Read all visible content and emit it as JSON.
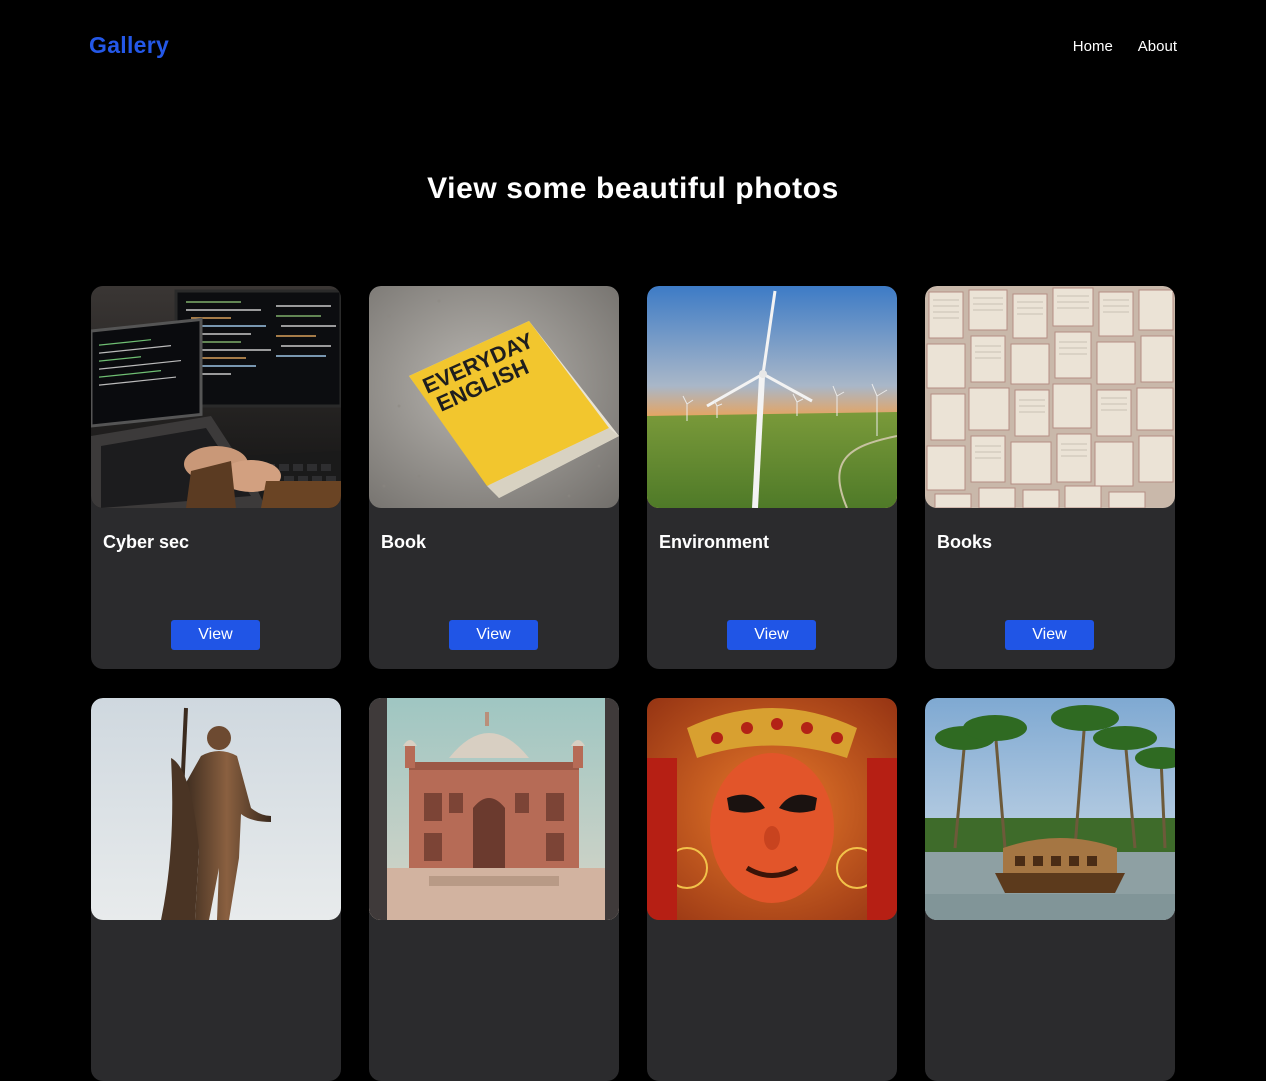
{
  "nav": {
    "brand": "Gallery",
    "links": [
      "Home",
      "About"
    ]
  },
  "hero": {
    "title": "View some beautiful photos"
  },
  "cards": [
    {
      "title": "Cyber sec",
      "button": "View"
    },
    {
      "title": "Book",
      "button": "View"
    },
    {
      "title": "Environment",
      "button": "View"
    },
    {
      "title": "Books",
      "button": "View"
    },
    {
      "title": "",
      "button": ""
    },
    {
      "title": "",
      "button": ""
    },
    {
      "title": "",
      "button": ""
    },
    {
      "title": "",
      "button": ""
    }
  ],
  "book_cover_text": [
    "EVERYDAY",
    "ENGLISH"
  ],
  "colors": {
    "background": "#000000",
    "card": "#2b2b2d",
    "accent": "#2055e6",
    "brand": "#2458e8"
  }
}
